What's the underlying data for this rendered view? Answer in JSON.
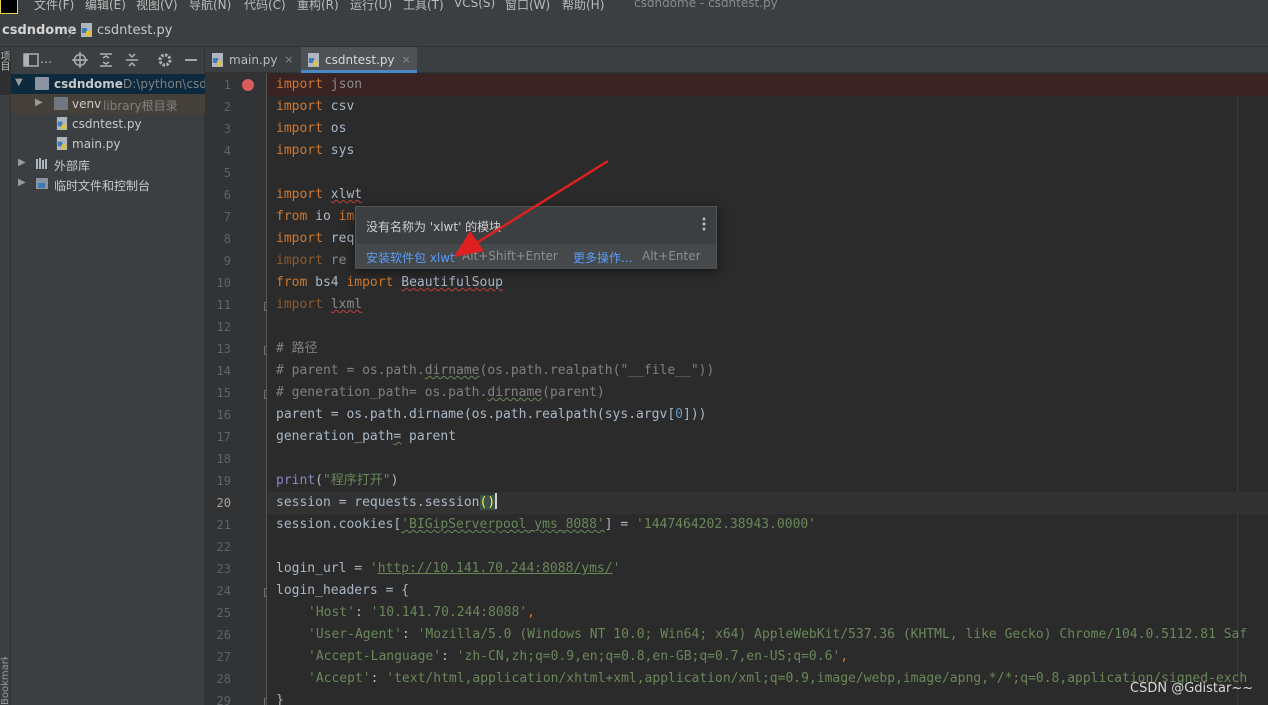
{
  "menu": {
    "items": [
      "文件(F)",
      "编辑(E)",
      "视图(V)",
      "导航(N)",
      "代码(C)",
      "重构(R)",
      "运行(U)",
      "工具(T)",
      "VCS(S)",
      "窗口(W)",
      "帮助(H)"
    ],
    "window_title": "csdndome - csdntest.py"
  },
  "breadcrumb": {
    "project": "csdndome",
    "separator": "〉",
    "file": "csdntest.py"
  },
  "toolstrip": {
    "project_label": "项目",
    "bookmarks_label": "Bookmarks"
  },
  "project_panel": {
    "title": "…",
    "tree": [
      {
        "label": "csdndome",
        "sub": "D:\\python\\csd"
      },
      {
        "label": "venv",
        "sub": "library根目录"
      },
      {
        "label": "csdntest.py"
      },
      {
        "label": "main.py"
      },
      {
        "label": "外部库"
      },
      {
        "label": "临时文件和控制台"
      }
    ]
  },
  "tabs": [
    {
      "label": "main.py",
      "close": "×"
    },
    {
      "label": "csdntest.py",
      "close": "×"
    }
  ],
  "editor": {
    "line_numbers": [
      "1",
      "2",
      "3",
      "4",
      "5",
      "6",
      "7",
      "8",
      "9",
      "10",
      "11",
      "12",
      "13",
      "14",
      "15",
      "16",
      "17",
      "18",
      "19",
      "20",
      "21",
      "22",
      "23",
      "24",
      "25",
      "26",
      "27",
      "28",
      "29"
    ],
    "current_line": "20",
    "code": {
      "l1_kw": "import",
      "l1_rest": " json",
      "l2_kw": "import",
      "l2_rest": " csv",
      "l3_kw": "import",
      "l3_rest": " os",
      "l4_kw": "import",
      "l4_rest": " sys",
      "l6_kw": "import",
      "l6_mod": "xlwt",
      "l7_kw": "from",
      "l7_mod": " io ",
      "l7_kw2": "im",
      "l8_kw": "import",
      "l8_rest": " req",
      "l9_kw": "import",
      "l9_rest": " re",
      "l10_kw": "from",
      "l10_mod": " bs4 ",
      "l10_kw2": "import",
      "l10_cls": "BeautifulSoup",
      "l11_kw": "import",
      "l11_mod": "lxml",
      "l13": "# 路径",
      "l14_a": "# parent = os.path.",
      "l14_b": "dirname",
      "l14_c": "(os.path.realpath(\"__file__\"))",
      "l15_a": "# generation_path= os.path.",
      "l15_b": "dirname",
      "l15_c": "(parent)",
      "l16_a": "parent = os.path.dirname(os.path.realpath(sys.argv[",
      "l16_num": "0",
      "l16_b": "]))",
      "l17_a": "generation_path",
      "l17_b": "=",
      "l17_c": " parent",
      "l19_fn": "print",
      "l19_a": "(",
      "l19_str": "\"程序打开\"",
      "l19_b": ")",
      "l20_a": "session = requests.session",
      "l20_paren": "()",
      "l21_a": "session.cookies[",
      "l21_key": "'BIGipServerpool_yms_8088'",
      "l21_b": "] = ",
      "l21_val": "'1447464202.38943.0000'",
      "l23_a": "login_url = ",
      "l23_q1": "'",
      "l23_url": "http://10.141.70.244:8088/yms/",
      "l23_q2": "'",
      "l24_a": "login_headers = {",
      "l25_k": "'Host'",
      "l25_s": ": ",
      "l25_v": "'10.141.70.244:8088'",
      "l25_e": ",",
      "l26_k": "'User-Agent'",
      "l26_s": ": ",
      "l26_v": "'Mozilla/5.0 (Windows NT 10.0; Win64; x64) AppleWebKit/537.36 (KHTML, like Gecko) Chrome/104.0.5112.81 Saf",
      "l27_k": "'Accept-Language'",
      "l27_s": ": ",
      "l27_v": "'zh-CN,zh;q=0.9,en;q=0.8,en-GB;q=0.7,en-US;q=0.6'",
      "l27_e": ",",
      "l28_k": "'Accept'",
      "l28_s": ": ",
      "l28_v": "'text/html,application/xhtml+xml,application/xml;q=0.9,image/webp,image/apng,*/*;q=0.8,application/signed-exch",
      "l29": "}"
    }
  },
  "popup": {
    "message": "没有名称为 'xlwt' 的模块",
    "install_label": "安装软件包 xlwt",
    "install_shortcut": "Alt+Shift+Enter",
    "more_label": "更多操作...",
    "more_shortcut": "Alt+Enter"
  },
  "watermark": "CSDN @Gdistar~~",
  "colors": {
    "keyword": "#cc7832",
    "string": "#6a8759",
    "comment": "#808080",
    "number": "#6897bb",
    "link": "#589df6",
    "annotation": "#e02020"
  }
}
